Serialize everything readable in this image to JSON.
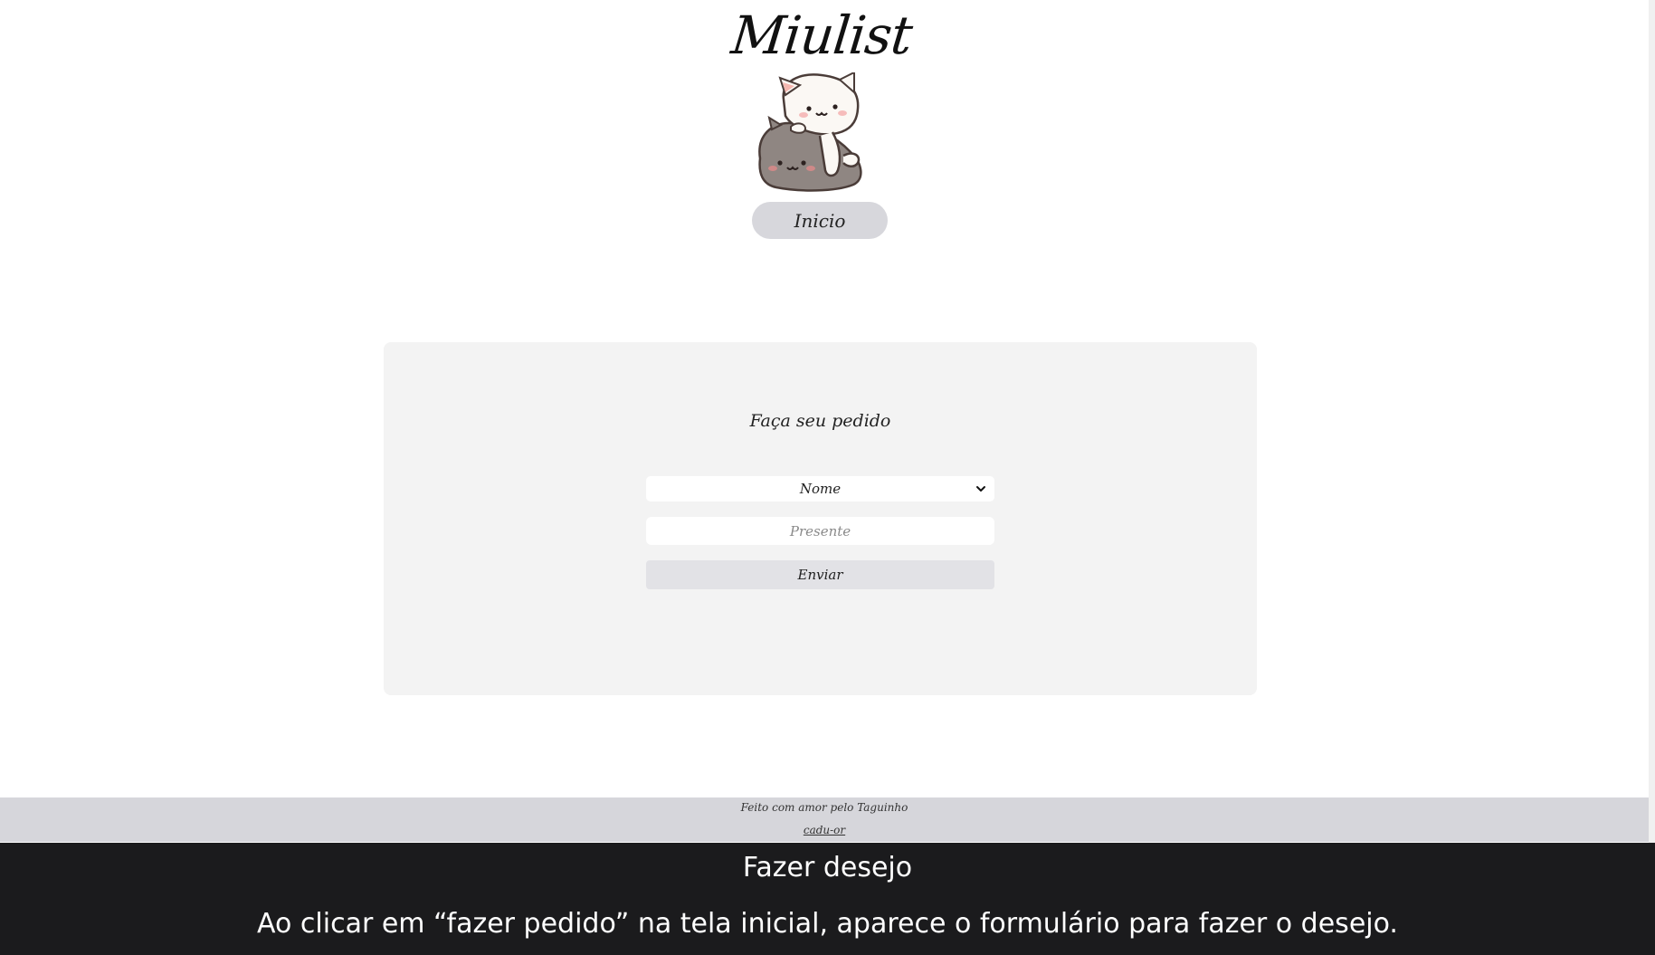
{
  "header": {
    "site_title": "Miulist",
    "mascot_icon": "cats-cuddling-icon",
    "home_label": "Inicio"
  },
  "form": {
    "title": "Faça seu pedido",
    "name_select": {
      "selected": "Nome"
    },
    "gift_input": {
      "value": "",
      "placeholder": "Presente"
    },
    "submit_label": "Enviar"
  },
  "footer": {
    "credit": "Feito com amor pelo Taguinho",
    "link": "cadu-or"
  },
  "caption": {
    "title": "Fazer desejo",
    "text": "Ao clicar em “fazer pedido” na tela inicial, aparece o formulário para fazer o desejo."
  },
  "colors": {
    "card_bg": "#f3f3f3",
    "button_bg": "#d7d7dc",
    "footer_bg": "#d6d6db",
    "caption_bg": "#1b1b1d"
  }
}
